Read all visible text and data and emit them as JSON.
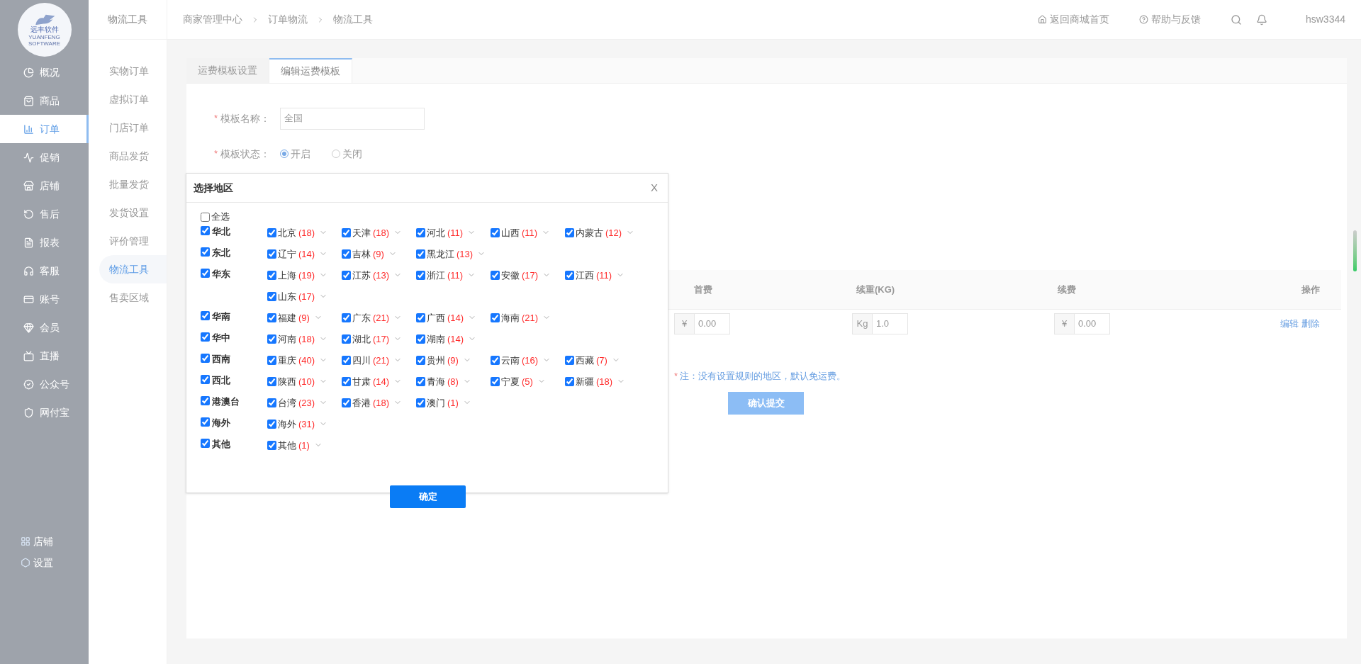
{
  "logo": {
    "title": "远丰软件",
    "subtitle": "YUANFENG SOFTWARE"
  },
  "sidebar": {
    "items": [
      {
        "label": "概况",
        "selected": false
      },
      {
        "label": "商品",
        "selected": false
      },
      {
        "label": "订单",
        "selected": true
      },
      {
        "label": "促销",
        "selected": false
      },
      {
        "label": "店铺",
        "selected": false
      },
      {
        "label": "售后",
        "selected": false
      },
      {
        "label": "报表",
        "selected": false
      },
      {
        "label": "客服",
        "selected": false
      },
      {
        "label": "账号",
        "selected": false
      },
      {
        "label": "会员",
        "selected": false
      },
      {
        "label": "直播",
        "selected": false
      },
      {
        "label": "公众号",
        "selected": false
      },
      {
        "label": "网付宝",
        "selected": false
      }
    ],
    "bottom": [
      "店铺",
      "设置"
    ]
  },
  "subnav": {
    "title": "物流工具",
    "items": [
      {
        "label": "实物订单",
        "selected": false
      },
      {
        "label": "虚拟订单",
        "selected": false
      },
      {
        "label": "门店订单",
        "selected": false
      },
      {
        "label": "商品发货",
        "selected": false
      },
      {
        "label": "批量发货",
        "selected": false
      },
      {
        "label": "发货设置",
        "selected": false
      },
      {
        "label": "评价管理",
        "selected": false
      },
      {
        "label": "物流工具",
        "selected": true
      },
      {
        "label": "售卖区域",
        "selected": false
      }
    ]
  },
  "breadcrumb": [
    "商家管理中心",
    "订单物流",
    "物流工具"
  ],
  "top_links": [
    "返回商城首页",
    "帮助与反馈"
  ],
  "user": "hsw3344",
  "tabs": [
    {
      "label": "运费模板设置",
      "selected": false
    },
    {
      "label": "编辑运费模板",
      "selected": true
    }
  ],
  "form": {
    "name_row": {
      "mark": "*",
      "label": "模板名称：",
      "value": "全国"
    },
    "status_row": {
      "mark": "*",
      "label": "模板状态：",
      "options": [
        {
          "label": "开启",
          "selected": true
        },
        {
          "label": "关闭",
          "selected": false
        }
      ]
    }
  },
  "table": {
    "columns": [
      "首费",
      "续重(KG)",
      "续费",
      "操作"
    ],
    "row": {
      "fields": [
        {
          "prefix": "¥",
          "value": "0.00"
        },
        {
          "prefix": "Kg",
          "value": "1.0"
        },
        {
          "prefix": "¥",
          "value": "0.00"
        }
      ],
      "actions": [
        "编辑",
        "删除"
      ]
    }
  },
  "note": {
    "mark": "*",
    "text": "注：没有设置规则的地区，默认免运费。"
  },
  "submit": "确认提交",
  "dialog": {
    "title": "选择地区",
    "close": "X",
    "select_all": {
      "label": "全选",
      "checked": false
    },
    "regions": [
      {
        "name": "华北",
        "checked": true,
        "provinces": [
          {
            "name": "北京",
            "count": "(18)",
            "checked": true
          },
          {
            "name": "天津",
            "count": "(18)",
            "checked": true
          },
          {
            "name": "河北",
            "count": "(11)",
            "checked": true
          },
          {
            "name": "山西",
            "count": "(11)",
            "checked": true
          },
          {
            "name": "内蒙古",
            "count": "(12)",
            "checked": true
          }
        ]
      },
      {
        "name": "东北",
        "checked": true,
        "provinces": [
          {
            "name": "辽宁",
            "count": "(14)",
            "checked": true
          },
          {
            "name": "吉林",
            "count": "(9)",
            "checked": true
          },
          {
            "name": "黑龙江",
            "count": "(13)",
            "checked": true
          }
        ]
      },
      {
        "name": "华东",
        "checked": true,
        "provinces": [
          {
            "name": "上海",
            "count": "(19)",
            "checked": true
          },
          {
            "name": "江苏",
            "count": "(13)",
            "checked": true
          },
          {
            "name": "浙江",
            "count": "(11)",
            "checked": true
          },
          {
            "name": "安徽",
            "count": "(17)",
            "checked": true
          },
          {
            "name": "江西",
            "count": "(11)",
            "checked": true
          },
          {
            "name": "山东",
            "count": "(17)",
            "checked": true
          }
        ]
      },
      {
        "name": "华南",
        "checked": true,
        "provinces": [
          {
            "name": "福建",
            "count": "(9)",
            "checked": true
          },
          {
            "name": "广东",
            "count": "(21)",
            "checked": true
          },
          {
            "name": "广西",
            "count": "(14)",
            "checked": true
          },
          {
            "name": "海南",
            "count": "(21)",
            "checked": true
          }
        ]
      },
      {
        "name": "华中",
        "checked": true,
        "provinces": [
          {
            "name": "河南",
            "count": "(18)",
            "checked": true
          },
          {
            "name": "湖北",
            "count": "(17)",
            "checked": true
          },
          {
            "name": "湖南",
            "count": "(14)",
            "checked": true
          }
        ]
      },
      {
        "name": "西南",
        "checked": true,
        "provinces": [
          {
            "name": "重庆",
            "count": "(40)",
            "checked": true
          },
          {
            "name": "四川",
            "count": "(21)",
            "checked": true
          },
          {
            "name": "贵州",
            "count": "(9)",
            "checked": true
          },
          {
            "name": "云南",
            "count": "(16)",
            "checked": true
          },
          {
            "name": "西藏",
            "count": "(7)",
            "checked": true
          }
        ]
      },
      {
        "name": "西北",
        "checked": true,
        "provinces": [
          {
            "name": "陕西",
            "count": "(10)",
            "checked": true
          },
          {
            "name": "甘肃",
            "count": "(14)",
            "checked": true
          },
          {
            "name": "青海",
            "count": "(8)",
            "checked": true
          },
          {
            "name": "宁夏",
            "count": "(5)",
            "checked": true
          },
          {
            "name": "新疆",
            "count": "(18)",
            "checked": true
          }
        ]
      },
      {
        "name": "港澳台",
        "checked": true,
        "provinces": [
          {
            "name": "台湾",
            "count": "(23)",
            "checked": true
          },
          {
            "name": "香港",
            "count": "(18)",
            "checked": true
          },
          {
            "name": "澳门",
            "count": "(1)",
            "checked": true
          }
        ]
      },
      {
        "name": "海外",
        "checked": true,
        "provinces": [
          {
            "name": "海外",
            "count": "(31)",
            "checked": true
          }
        ]
      },
      {
        "name": "其他",
        "checked": true,
        "provinces": [
          {
            "name": "其他",
            "count": "(1)",
            "checked": true
          }
        ]
      }
    ],
    "confirm": "确定"
  }
}
